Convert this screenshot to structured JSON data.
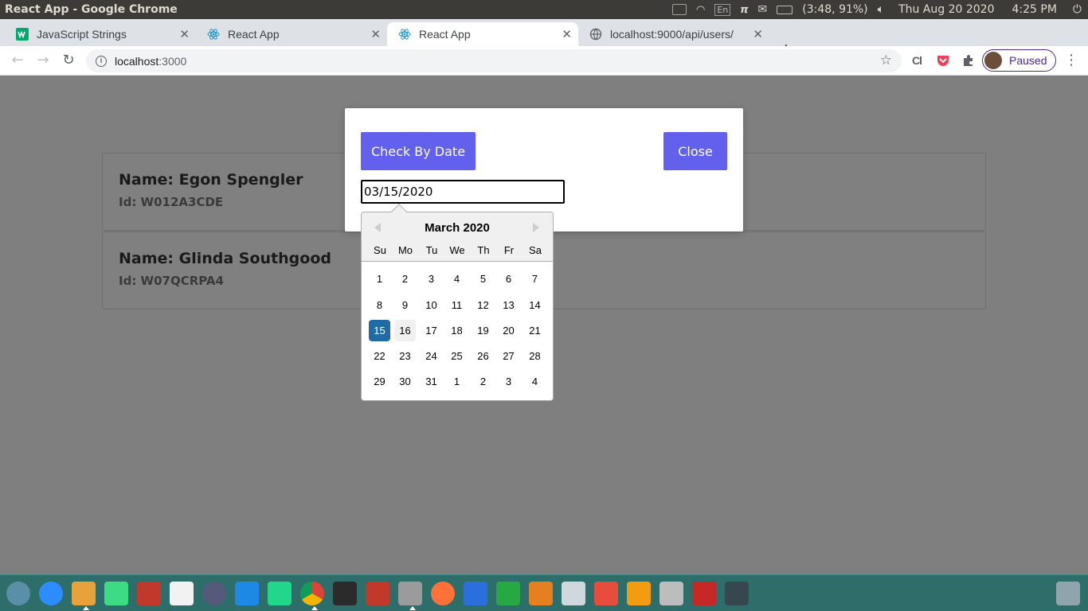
{
  "system": {
    "window_title": "React App - Google Chrome",
    "battery": "(3:48, 91%)",
    "keyboard_lang": "En",
    "date": "Thu Aug 20 2020",
    "time": "4:25 PM"
  },
  "browser": {
    "tabs": [
      {
        "label": "JavaScript Strings",
        "favicon": "w3schools-icon",
        "active": false
      },
      {
        "label": "React App",
        "favicon": "react-icon",
        "active": false
      },
      {
        "label": "React App",
        "favicon": "react-icon",
        "active": true
      },
      {
        "label": "localhost:9000/api/users/",
        "favicon": "globe-icon",
        "active": false
      }
    ],
    "url_host": "localhost",
    "url_port": ":3000",
    "profile_label": "Paused"
  },
  "page": {
    "users": [
      {
        "name": "Name: Egon Spengler",
        "id": "Id: W012A3CDE"
      },
      {
        "name": "Name: Glinda Southgood",
        "id": "Id: W07QCRPA4"
      }
    ]
  },
  "modal": {
    "check_button": "Check By Date",
    "close_button": "Close",
    "date_value": "03/15/2020"
  },
  "datepicker": {
    "month_label": "March 2020",
    "day_names": [
      "Su",
      "Mo",
      "Tu",
      "We",
      "Th",
      "Fr",
      "Sa"
    ],
    "weeks": [
      [
        "1",
        "2",
        "3",
        "4",
        "5",
        "6",
        "7"
      ],
      [
        "8",
        "9",
        "10",
        "11",
        "12",
        "13",
        "14"
      ],
      [
        "15",
        "16",
        "17",
        "18",
        "19",
        "20",
        "21"
      ],
      [
        "22",
        "23",
        "24",
        "25",
        "26",
        "27",
        "28"
      ],
      [
        "29",
        "30",
        "31",
        "1",
        "2",
        "3",
        "4"
      ]
    ],
    "selected_day": "15",
    "keyboard_day": "16"
  },
  "colors": {
    "primary_button": "#6360ee",
    "selected_day": "#216ba5",
    "overlay": "#7f7f7f",
    "dock": "#2e6e6a"
  },
  "dock": {
    "apps": [
      "ubuntu-software-icon",
      "zoom-icon",
      "text-editor-icon",
      "android-studio-icon",
      "terminal-red-icon",
      "document-viewer-icon",
      "settings-gear-icon",
      "vscode-icon",
      "pycharm-icon",
      "chrome-icon",
      "terminal-icon",
      "terminal-red-2-icon",
      "files-icon",
      "firefox-icon",
      "writer-icon",
      "calc-icon",
      "impress-icon",
      "screenshot-icon",
      "tweaks-icon",
      "software-store-icon",
      "system-monitor-icon",
      "checker-icon",
      "workspace-icon",
      "trash-icon"
    ]
  }
}
